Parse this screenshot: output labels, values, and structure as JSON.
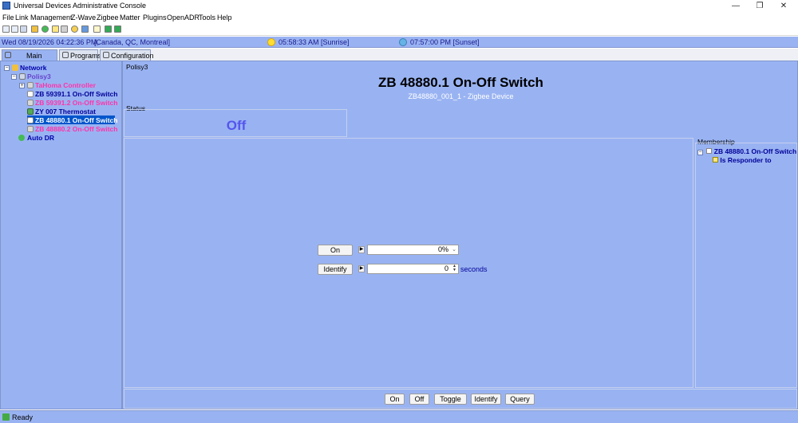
{
  "window": {
    "title": "Universal Devices Administrative Console",
    "minimize": "—",
    "maximize": "❐",
    "close": "✕"
  },
  "menu": [
    "File",
    "Link Management",
    "Z-Wave",
    "Zigbee",
    "Matter",
    "Plugins",
    "OpenADR",
    "Tools",
    "Help"
  ],
  "infobar": {
    "datetime": "Wed 08/19/2026 04:22:36 PM,",
    "location": "[Canada, QC, Montreal]",
    "sunrise": "05:58:33 AM [Sunrise]",
    "sunset": "07:57:00 PM [Sunset]",
    "sunrise_icon": "sun-icon",
    "sunset_icon": "moon-icon"
  },
  "tabs": [
    {
      "label": "Main",
      "icon": "home-icon",
      "active": true
    },
    {
      "label": "Programs",
      "icon": "programs-icon",
      "active": false
    },
    {
      "label": "Configuration",
      "icon": "wrench-icon",
      "active": false
    }
  ],
  "tree": {
    "network": "Network",
    "polisy": "Polisy3",
    "tahoma": "TaHoma Controller",
    "zb59391_1": "ZB 59391.1 On-Off Switch",
    "zb59391_2": "ZB 59391.2 On-Off Switch",
    "zy007": "ZY 007 Thermostat",
    "zb48880_1": "ZB 48880.1 On-Off Switch",
    "zb48880_2": "ZB 48880.2 On-Off Switch",
    "autodr": "Auto DR"
  },
  "main": {
    "breadcrumb": "Polisy3",
    "device_title": "ZB 48880.1 On-Off Switch",
    "device_subtitle": "ZB48880_001_1 - Zigbee Device",
    "status_label": "Status",
    "status_value": "Off",
    "on_button": "On",
    "on_level": "0%",
    "identify_button": "Identify",
    "identify_value": "0",
    "seconds_label": "seconds",
    "membership_label": "Membership",
    "membership_device": "ZB 48880.1 On-Off Switch",
    "membership_role": "Is Responder to"
  },
  "bottom_buttons": [
    "On",
    "Off",
    "Toggle",
    "Identify",
    "Query"
  ],
  "statusbar": {
    "text": "Ready"
  },
  "colors": {
    "panel_bg": "#99b3f2",
    "status_value": "#5555ee",
    "pink_node": "#ff33aa",
    "navy_text": "#000099",
    "selection": "#0055cc"
  }
}
